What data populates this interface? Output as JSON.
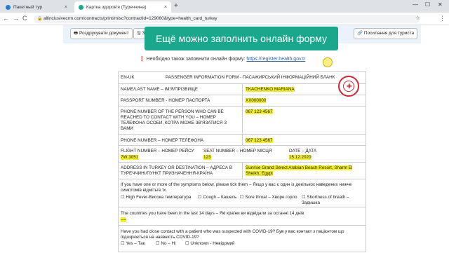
{
  "browser": {
    "tabs": [
      {
        "label": "Пакетный тур",
        "close": "×"
      },
      {
        "label": "Картка здоров'я (Туреччина)",
        "close": "×"
      }
    ],
    "new_tab": "+",
    "window_controls": {
      "minimize": "—",
      "maximize": "☐",
      "close": "✕"
    },
    "url": "allinclusivecrm.com/contracts/print/misc?contractId=129060&type=health_card_turkey",
    "back": "←",
    "forward": "→",
    "reload": "C",
    "lock": "🔒",
    "star": "☆",
    "menu": "⋮"
  },
  "toolbar": {
    "print_label": "🖶 Роздрукувати документ",
    "second_label": "🖫 Зб",
    "link_label": "🔗 Посилання для туриста"
  },
  "overlay_text": "Ещё можно заполнить онлайн форму",
  "notice": {
    "icon": "❗",
    "text": "Необхідно також заповнити онлайн форму: ",
    "link": "https://register.health.gov.tr"
  },
  "form": {
    "header_left": "EN-UK",
    "header_title": "PASSENGER INFORMATION FORM - ПАСАЖИРСЬКИЙ ІНФОРМАЦІЙНИЙ БЛАНК",
    "name_label": "NAME/LAST NAME – ІМ'Я/ПРІЗВИЩЕ",
    "name_value": "TKACHENKO MARIANA",
    "passport_label": "PASSPORT NUMBER - НОМЕР ПАСПОРТА",
    "passport_value": "XX000000",
    "contact_label": "PHONE NUMBER OF THE PERSON WHO CAN BE REACHED TO CONTACT WITH YOU – НОМЕР ТЕЛЕФОНА ОСОБИ, КОТРА МОЖЕ ЗВ'ЯЗАТИСЯ З ВАМИ",
    "contact_value": "067 123 4567",
    "phone_label": "PHONE NUMBER – НОМЕР ТЕЛЕФОНА",
    "phone_value": "067 123 4567",
    "flight_label": "FLIGHT NUMBER – НОМЕР РЕЙСУ",
    "flight_value": "7W 3051",
    "seat_label": "SEAT NUMBER – НОМЕР МІСЦЯ",
    "seat_value": "123",
    "date_label": "DATE – ДАТА",
    "date_value": "15.12.2020",
    "address_label": "ADDRESS IN TURKEY OR DESTINATION – АДРЕСА В ТУРЕЧЧИНІ/ПУНКТ ПРИЗНАЧЕННЯ-КРАЇНА",
    "address_value": "Sunrise Grand Select Arabian Beach Resort, Sharm El Sheikh, Egypt",
    "symptoms_text": "If you have one or more of the symptoms below, please tick them – Якщо у вас є один із декількох наведених нижче симптомів відмітьте їх.",
    "symptom_options": [
      "☐ High Fever-Висока температура",
      "☐ Cough – Кашель",
      "☐ Sore throat – Хворе горло",
      "☐ Shortness of breath – Задишка"
    ],
    "countries_text": "The countries you have been in the last 14 days – Які країни ви відвідали за останні 14 днів",
    "countries_value": "----",
    "covid_text": "Have you had close contact with a patient who was suspected with COVID-19? Був у вас контакт з пацієнтом що підозрюється на наявність COVID-19?",
    "covid_options": [
      "☐ Yes – Так",
      "☐ No – Ні",
      "☐ Unknown - Невідомий"
    ]
  }
}
